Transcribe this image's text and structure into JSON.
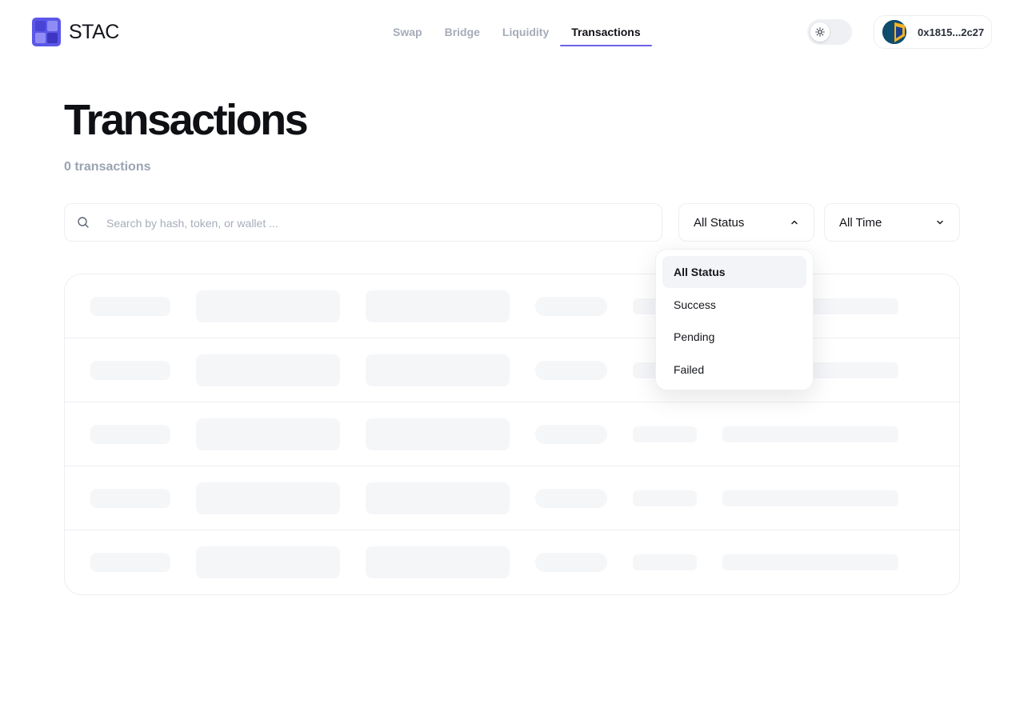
{
  "header": {
    "brand": "STAC",
    "nav": [
      {
        "label": "Swap",
        "active": false
      },
      {
        "label": "Bridge",
        "active": false
      },
      {
        "label": "Liquidity",
        "active": false
      },
      {
        "label": "Transactions",
        "active": true
      }
    ],
    "theme_icon": "sun-icon",
    "wallet_address": "0x1815...2c27"
  },
  "page": {
    "title": "Transactions",
    "count_text": "0 transactions"
  },
  "search": {
    "placeholder": "Search by hash, token, or wallet ...",
    "value": ""
  },
  "filters": {
    "status": {
      "selected": "All Status",
      "open": true
    },
    "time": {
      "selected": "All Time",
      "open": false
    }
  },
  "status_dropdown": {
    "options": [
      "All Status",
      "Success",
      "Pending",
      "Failed"
    ],
    "selected_index": 0
  },
  "colors": {
    "accent": "#6c63e6",
    "brand": "#5b57e8",
    "muted_text": "#9aa3b1",
    "skeleton": "#f5f6f8"
  }
}
